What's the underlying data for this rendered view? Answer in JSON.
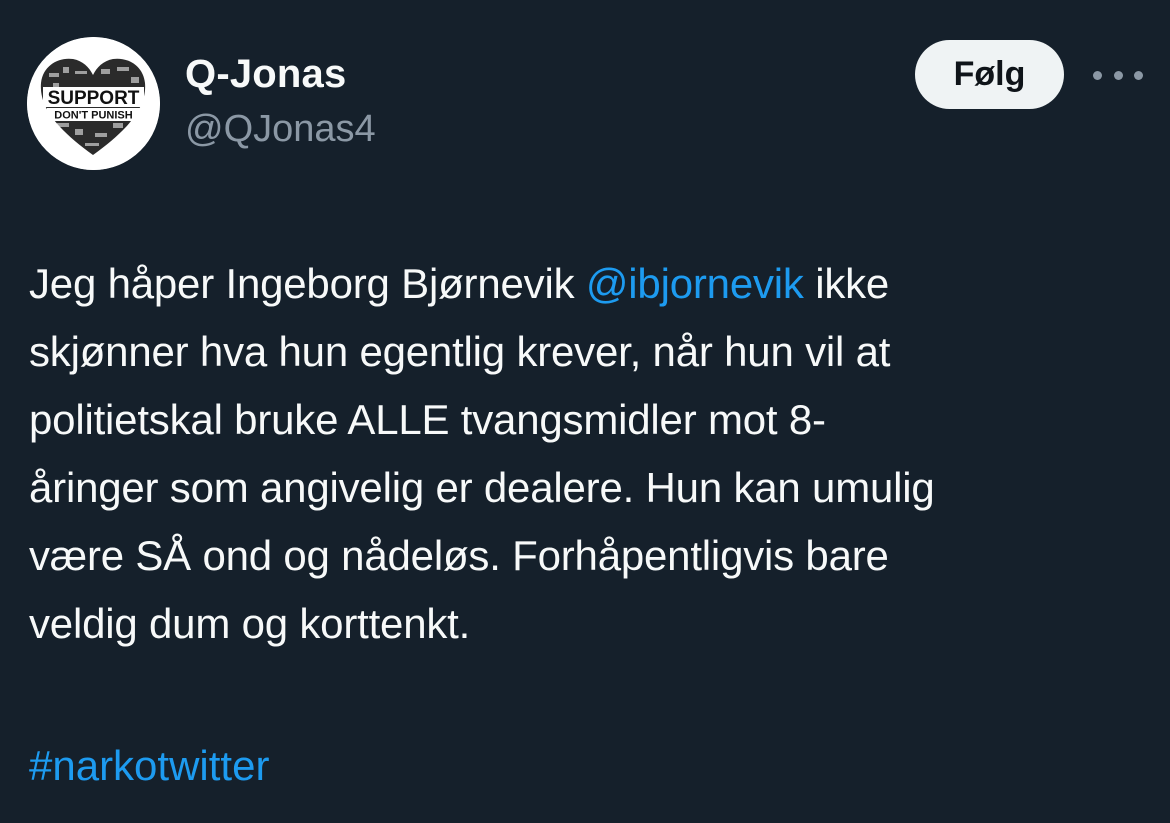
{
  "author": {
    "display_name": "Q-Jonas",
    "handle": "@QJonas4",
    "avatar": {
      "line1": "SUPPORT",
      "line2": "DON'T PUNISH"
    }
  },
  "actions": {
    "follow_label": "Følg",
    "more_icon": "more-horizontal-icon"
  },
  "tweet": {
    "line1_before": "Jeg håper Ingeborg Bjørnevik ",
    "mention": "@ibjornevik",
    "line1_after": " ikke",
    "line2": "skjønner hva hun egentlig krever, når hun vil at",
    "line3": "politietskal bruke ALLE tvangsmidler mot 8-",
    "line4": "åringer som angivelig er dealere. Hun kan umulig",
    "line5": "være SÅ ond og nådeløs. Forhåpentligvis bare",
    "line6": "veldig dum og korttenkt.",
    "hashtag": "#narkotwitter"
  },
  "colors": {
    "background": "#15202b",
    "text": "#f7f9f9",
    "secondary": "#8b98a5",
    "link": "#1d9bf0",
    "button": "#eff3f4"
  }
}
